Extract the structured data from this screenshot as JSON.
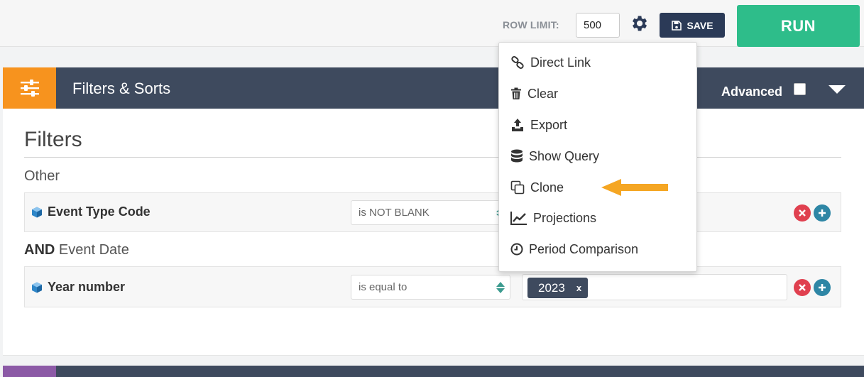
{
  "toolbar": {
    "row_limit_label": "ROW LIMIT:",
    "row_limit_value": "500",
    "settings_icon": "gear-icon",
    "save_label": "SAVE",
    "save_icon": "floppy-disk-icon",
    "run_label": "RUN",
    "run_color": "#2ebd8a"
  },
  "section": {
    "title": "Filters & Sorts",
    "icon": "sliders-icon",
    "advanced_label": "Advanced",
    "advanced_checked": false
  },
  "filters": {
    "title": "Filters",
    "groups": [
      {
        "label_prefix": "",
        "label": "Other",
        "field": "Event Type Code",
        "operator": "is NOT BLANK",
        "values": []
      },
      {
        "label_prefix": "AND",
        "label": "Event Date",
        "field": "Year number",
        "operator": "is equal to",
        "values": [
          "2023"
        ]
      }
    ],
    "chip_remove": "x"
  },
  "menu": {
    "items": [
      {
        "label": "Direct Link",
        "icon": "link-icon"
      },
      {
        "label": "Clear",
        "icon": "trash-icon"
      },
      {
        "label": "Export",
        "icon": "export-icon"
      },
      {
        "label": "Show Query",
        "icon": "database-icon"
      },
      {
        "label": "Clone",
        "icon": "clone-icon"
      },
      {
        "label": "Projections",
        "icon": "line-chart-icon"
      },
      {
        "label": "Period Comparison",
        "icon": "clock-icon"
      }
    ]
  },
  "colors": {
    "header": "#3e4a5e",
    "accent_orange": "#f7931e",
    "annotation_arrow": "#f5a623"
  }
}
